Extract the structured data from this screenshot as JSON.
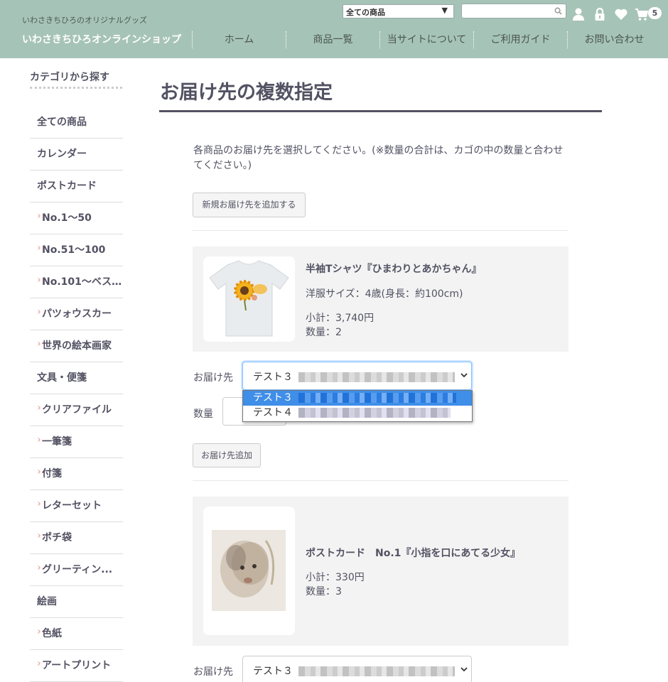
{
  "header": {
    "tagline": "いわさきちひろのオリジナルグッズ",
    "shop_name": "いわさきちひろオンラインショップ",
    "category_select": "全ての商品",
    "search_placeholder": "",
    "cart_count": "5",
    "nav": [
      "ホーム",
      "商品一覧",
      "当サイトについて",
      "ご利用ガイド",
      "お問い合わせ"
    ]
  },
  "sidebar": {
    "title": "カテゴリから探す",
    "items": [
      {
        "label": "全ての商品",
        "sub": false
      },
      {
        "label": "カレンダー",
        "sub": false
      },
      {
        "label": "ポストカード",
        "sub": false
      },
      {
        "label": "No.1〜50",
        "sub": true
      },
      {
        "label": "No.51〜100",
        "sub": true
      },
      {
        "label": "No.101〜ベス...",
        "sub": true
      },
      {
        "label": "パツォウスカー",
        "sub": true
      },
      {
        "label": "世界の絵本画家",
        "sub": true
      },
      {
        "label": "文具・便箋",
        "sub": false
      },
      {
        "label": "クリアファイル",
        "sub": true
      },
      {
        "label": "一筆箋",
        "sub": true
      },
      {
        "label": "付箋",
        "sub": true
      },
      {
        "label": "レターセット",
        "sub": true
      },
      {
        "label": "ポチ袋",
        "sub": true
      },
      {
        "label": "グリーティン...",
        "sub": true
      },
      {
        "label": "絵画",
        "sub": false
      },
      {
        "label": "色紙",
        "sub": true
      },
      {
        "label": "アートプリント",
        "sub": true
      }
    ]
  },
  "main": {
    "title": "お届け先の複数指定",
    "description": "各商品のお届け先を選択してください。(※数量の合計は、カゴの中の数量と合わせてください。)",
    "add_new_address_button": "新規お届け先を追加する",
    "items": [
      {
        "name": "半袖Tシャツ『ひまわりとあかちゃん』",
        "option": "洋服サイズ：4歳(身長：約100cm)",
        "subtotal": "小計：3,740円",
        "quantity": "数量：2",
        "ship_label": "お届け先",
        "ship_value": "テスト３",
        "qty_label": "数量",
        "add_ship_button": "お届け先追加"
      },
      {
        "name": "ポストカード　No.1『小指を口にあてる少女』",
        "subtotal": "小計：330円",
        "quantity": "数量：3",
        "ship_label": "お届け先",
        "ship_value": "テスト３"
      }
    ],
    "dropdown_options": [
      "テスト３",
      "テスト４"
    ]
  },
  "colors": {
    "header_bg": "#a6c3b8",
    "text": "#525263",
    "dropdown_selected": "#3f8ee8"
  }
}
